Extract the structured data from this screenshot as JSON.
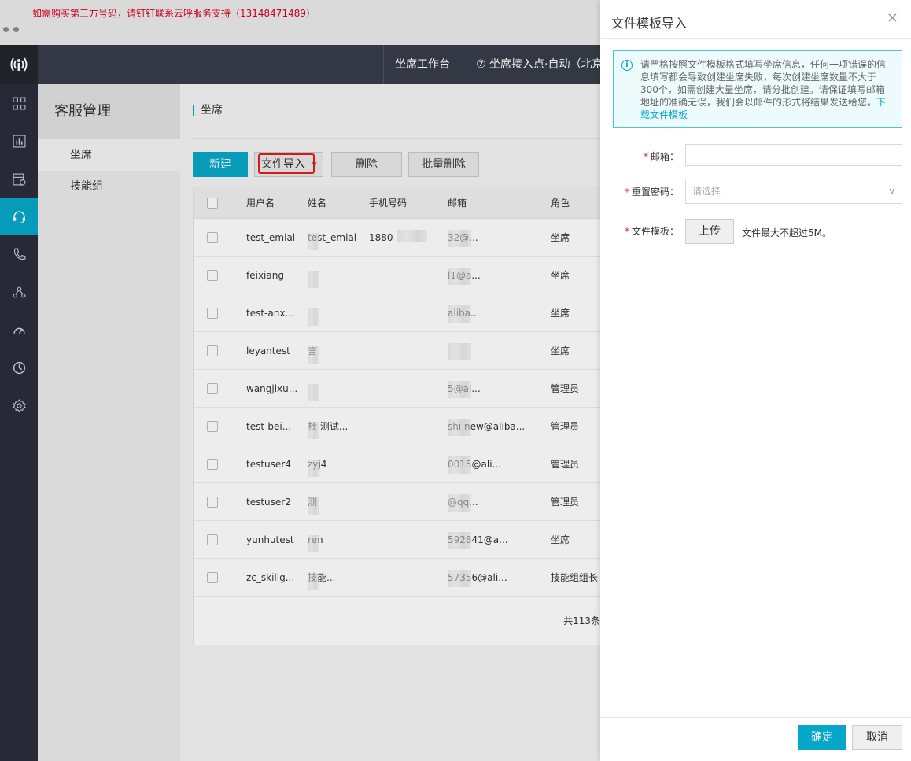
{
  "notice": {
    "text": "如需购买第三方号码，请钉钉联系云呼服务支持（13148471489）"
  },
  "header": {
    "workbench": "坐席工作台",
    "access_point": "⑦ 坐席接入点·自动（北京"
  },
  "rail": {
    "items": [
      "logo-icon",
      "grid-icon",
      "chart-icon",
      "calendar-icon",
      "headset-icon",
      "phone-icon",
      "flow-icon",
      "gauge-icon",
      "clock-icon",
      "gear-icon"
    ],
    "active": "headset-icon"
  },
  "submenu": {
    "title": "客服管理",
    "items": [
      {
        "label": "坐席",
        "active": true
      },
      {
        "label": "技能组",
        "active": false
      }
    ]
  },
  "main": {
    "page_title": "坐席",
    "buttons": {
      "new": "新建",
      "file_import": "文件导入",
      "delete": "删除",
      "batch_delete": "批量删除"
    },
    "table": {
      "columns": [
        "用户名",
        "姓名",
        "手机号码",
        "邮箱",
        "角色"
      ],
      "rows": [
        {
          "username": "test_emial",
          "name": "test_emial",
          "phone": "1880",
          "email": "32@...",
          "role": "坐席"
        },
        {
          "username": "feixiang",
          "name": "",
          "phone": "",
          "email": "l1@a...",
          "role": "坐席"
        },
        {
          "username": "test-anx...",
          "name": "",
          "phone": "",
          "email": "aliba...",
          "role": "坐席"
        },
        {
          "username": "leyantest",
          "name": "言",
          "phone": "",
          "email": "",
          "role": "坐席"
        },
        {
          "username": "wangjixu...",
          "name": "",
          "phone": "",
          "email": "5@al...",
          "role": "管理员"
        },
        {
          "username": "test-bei...",
          "name": "杜 测试...",
          "phone": "",
          "email": "shi   new@aliba...",
          "role": "管理员"
        },
        {
          "username": "testuser4",
          "name": "zyj4",
          "phone": "",
          "email": "0015@ali...",
          "role": "管理员"
        },
        {
          "username": "testuser2",
          "name": "测",
          "phone": "",
          "email": "@qq...",
          "role": "管理员"
        },
        {
          "username": "yunhutest",
          "name": "ren",
          "phone": "",
          "email": "592841@a...",
          "role": "坐席"
        },
        {
          "username": "zc_skillg...",
          "name": "技能...",
          "phone": "",
          "email": "57356@ali...",
          "role": "技能组组长"
        }
      ],
      "total": "共113条"
    }
  },
  "drawer": {
    "title": "文件模板导入",
    "close": "×",
    "alert_text": "请严格按照文件模板格式填写坐席信息，任何一项错误的信息填写都会导致创建坐席失败，每次创建坐席数量不大于300个，如需创建大量坐席，请分批创建。请保证填写邮箱地址的准确无误，我们会以邮件的形式将结果发送给您。",
    "alert_link": "下载文件模板",
    "form": {
      "email_label": "邮箱：",
      "email_value": "",
      "password_label": "重置密码：",
      "password_placeholder": "请选择",
      "template_label": "文件模板：",
      "upload_button": "上传",
      "upload_hint": "文件最大不超过5M。"
    },
    "footer": {
      "ok": "确定",
      "cancel": "取消"
    }
  }
}
